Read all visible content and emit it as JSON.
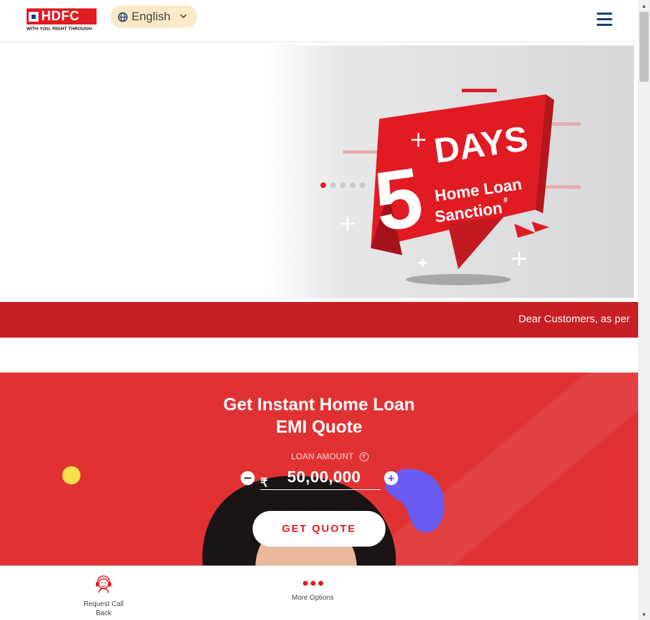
{
  "header": {
    "logo_text": "HDFC",
    "logo_tagline": "WITH YOU, RIGHT THROUGH",
    "language": "English"
  },
  "banner": {
    "number": "5",
    "days": "DAYS",
    "line1": "Home Loan",
    "line2": "Sanction",
    "mark": "#",
    "slide_count": 5,
    "active_slide": 1
  },
  "ticker": {
    "text": "Dear Customers, as per"
  },
  "emi": {
    "title_line1": "Get Instant Home Loan",
    "title_line2": "EMI Quote",
    "loan_label": "LOAN AMOUNT",
    "rupee_symbol": "₹",
    "amount": "50,00,000",
    "button": "GET QUOTE"
  },
  "bottom_bar": {
    "call_label_1": "Request Call",
    "call_label_2": "Back",
    "more_label": "More Options"
  },
  "colors": {
    "brand_red": "#e11b22",
    "emi_bg": "#e03233",
    "ticker_bg": "#c81f25",
    "lang_bg": "#fbe9c8",
    "menu": "#1c3b6e"
  },
  "icons": [
    "globe-icon",
    "chevron-down-icon",
    "hamburger-menu-icon",
    "minus-icon",
    "plus-icon",
    "headset-agent-icon",
    "more-dots-icon"
  ]
}
